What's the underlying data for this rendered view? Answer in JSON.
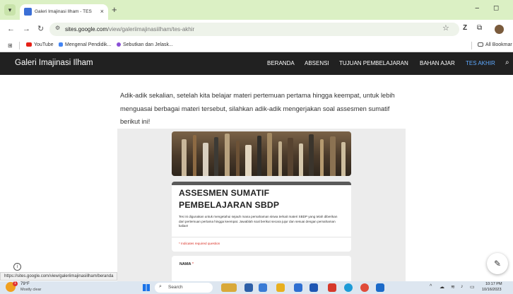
{
  "browser": {
    "tab_title": "Galeri Imajinasi Ilham - TES AKH",
    "tab_close": "×",
    "new_tab": "+",
    "minimize": "−",
    "maximize": "◻",
    "url_host": "sites.google.com",
    "url_path": "/view/galeriimajinasiilham/tes-akhir",
    "bookmarks": [
      "YouTube",
      "Mengenal Pendidik...",
      "Sebutkan dan Jelask..."
    ],
    "all_bookmarks": "All Bookmar",
    "icons": {
      "back": "back-arrow-icon",
      "forward": "forward-arrow-icon",
      "reload": "reload-icon",
      "star": "star-icon"
    }
  },
  "site": {
    "title": "Galeri Imajinasi Ilham",
    "nav": [
      "BERANDA",
      "ABSENSI",
      "TUJUAN PEMBELAJARAN",
      "BAHAN AJAR",
      "TES AKHIR"
    ],
    "active_nav": "TES AKHIR",
    "active_color": "#5ea9ff",
    "header_bg": "#212121"
  },
  "content": {
    "intro": "Adik-adik sekalian, setelah kita belajar materi pertemuan pertama hingga keempat, untuk lebih menguasai berbagai materi tersebut, silahkan adik-adik mengerjakan soal assesmen sumatif berikut ini!"
  },
  "form": {
    "title": "ASSESMEN SUMATIF PEMBELAJARAN SBDP",
    "description": "Tes ini digunakan untuk mengetahui sejauh mana pemahaman siswa terkait materi SBDP yang telah diberikan dari pertemuan pertama hingga keempat. Jawablah soal berikut secara jujur dan sesuai dengan pemahaman kalian!",
    "required_note": "* Indicates required question",
    "question_label": "NAMA",
    "required_mark": "*"
  },
  "status_url": "https://sites.google.com/view/galeriimajinasiilham/beranda",
  "taskbar": {
    "weather_temp": "79°F",
    "weather_desc": "Mostly clear",
    "weather_badge": "1",
    "search_label": "Search",
    "time": "10:17 PM",
    "date": "10/16/2023"
  }
}
